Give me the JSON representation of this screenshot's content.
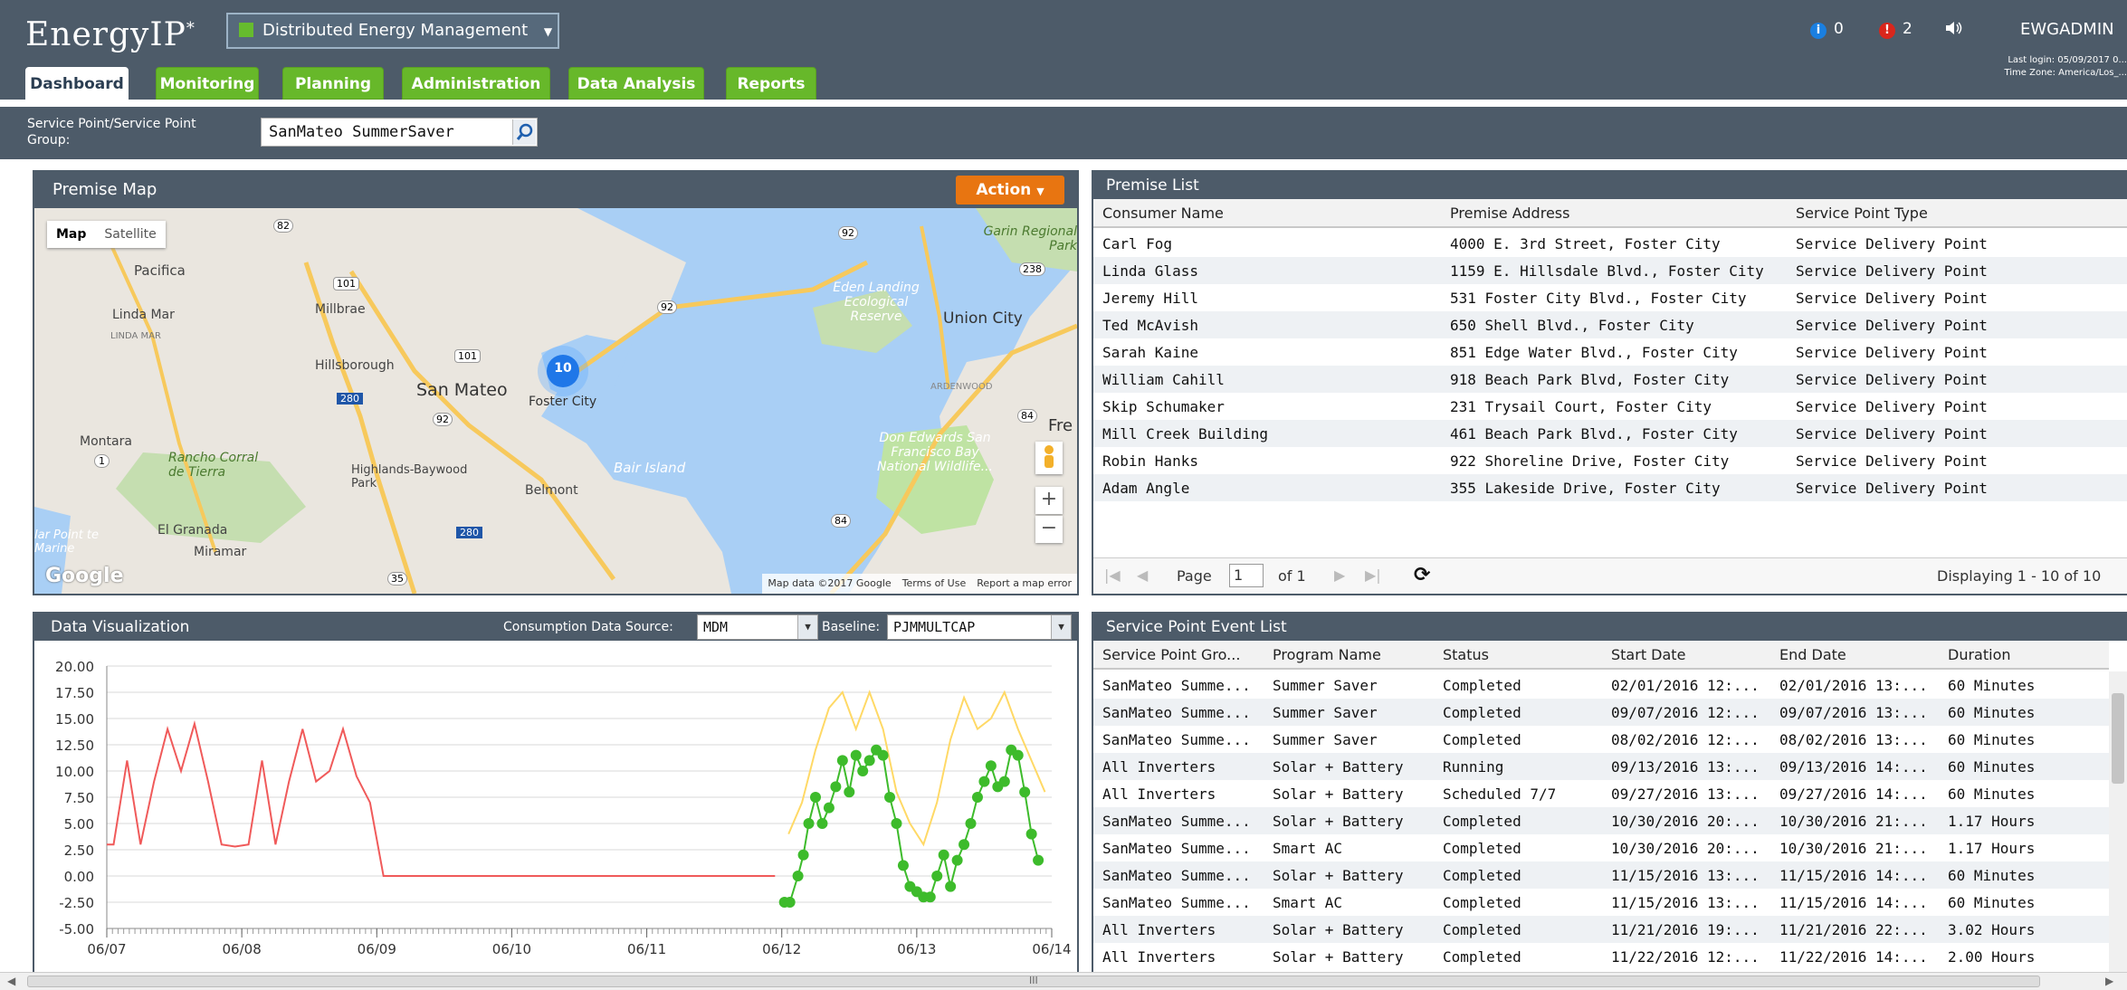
{
  "header": {
    "logo_text": "EnergyIP",
    "logo_mark": "*",
    "app_selector": "Distributed Energy Management",
    "info_count": "0",
    "alert_count": "2",
    "info_icon_letter": "i",
    "alert_icon_letter": "!",
    "username": "EWGADMIN",
    "last_login": "Last login: 05/09/2017 0...",
    "time_zone": "Time Zone: America/Los_..."
  },
  "tabs": [
    "Dashboard",
    "Monitoring",
    "Planning",
    "Administration",
    "Data Analysis",
    "Reports"
  ],
  "filter": {
    "label": "Service Point/Service Point Group:",
    "value": "SanMateo SummerSaver"
  },
  "premise_map": {
    "title": "Premise Map",
    "action_label": "Action",
    "map_type_map": "Map",
    "map_type_satellite": "Satellite",
    "cluster_count": "10",
    "zoom_in": "+",
    "zoom_out": "−",
    "google": "Google",
    "footer_mapdata": "Map data ©2017 Google",
    "footer_terms": "Terms of Use",
    "footer_report": "Report a map error",
    "places": [
      "Pacifica",
      "Linda Mar",
      "Millbrae",
      "Hillsborough",
      "San Mateo",
      "Foster City",
      "Montara",
      "Rancho Corral de Tierra",
      "Highlands-Baywood Park",
      "Belmont",
      "El Granada",
      "Miramar",
      "Garin Regional Park",
      "Eden Landing Ecological Reserve",
      "Union City",
      "Don Edwards San Francisco Bay National Wildlife...",
      "Bair Island",
      "lar Point te Marine",
      "Fre",
      "ARDENWOOD",
      "LINDA MAR"
    ],
    "roads": [
      "101",
      "280",
      "92",
      "1",
      "84",
      "238",
      "35",
      "82"
    ]
  },
  "premise_list": {
    "title": "Premise List",
    "columns": [
      "Consumer Name",
      "Premise Address",
      "Service Point Type"
    ],
    "rows": [
      [
        "Carl Fog",
        "4000 E. 3rd Street, Foster City",
        "Service Delivery Point"
      ],
      [
        "Linda Glass",
        "1159 E. Hillsdale Blvd., Foster City",
        "Service Delivery Point"
      ],
      [
        "Jeremy Hill",
        "531 Foster City Blvd., Foster City",
        "Service Delivery Point"
      ],
      [
        "Ted McAvish",
        "650 Shell Blvd., Foster City",
        "Service Delivery Point"
      ],
      [
        "Sarah Kaine",
        "851 Edge Water Blvd., Foster City",
        "Service Delivery Point"
      ],
      [
        "William Cahill",
        "918 Beach Park Blvd, Foster City",
        "Service Delivery Point"
      ],
      [
        "Skip Schumaker",
        "231 Trysail Court, Foster City",
        "Service Delivery Point"
      ],
      [
        "Mill Creek Building",
        "461 Beach Park Blvd., Foster City",
        "Service Delivery Point"
      ],
      [
        "Robin Hanks",
        "922 Shoreline Drive, Foster City",
        "Service Delivery Point"
      ],
      [
        "Adam Angle",
        "355 Lakeside Drive, Foster City",
        "Service Delivery Point"
      ]
    ],
    "pager_page_label": "Page",
    "pager_page": "1",
    "pager_of": "of 1",
    "pager_display": "Displaying 1 - 10 of 10"
  },
  "data_viz": {
    "title": "Data Visualization",
    "source_label": "Consumption Data Source:",
    "source_value": "MDM",
    "baseline_label": "Baseline:",
    "baseline_value": "PJMMULTCAP"
  },
  "event_list": {
    "title": "Service Point Event List",
    "columns": [
      "Service Point Gro...",
      "Program Name",
      "Status",
      "Start Date",
      "End Date",
      "Duration"
    ],
    "rows": [
      [
        "SanMateo Summe...",
        "Summer Saver",
        "Completed",
        "02/01/2016 12:...",
        "02/01/2016 13:...",
        "60 Minutes"
      ],
      [
        "SanMateo Summe...",
        "Summer Saver",
        "Completed",
        "09/07/2016 12:...",
        "09/07/2016 13:...",
        "60 Minutes"
      ],
      [
        "SanMateo Summe...",
        "Summer Saver",
        "Completed",
        "08/02/2016 12:...",
        "08/02/2016 13:...",
        "60 Minutes"
      ],
      [
        "All Inverters",
        "Solar + Battery",
        "Running",
        "09/13/2016 13:...",
        "09/13/2016 14:...",
        "60 Minutes"
      ],
      [
        "All Inverters",
        "Solar + Battery",
        "Scheduled 7/7",
        "09/27/2016 13:...",
        "09/27/2016 14:...",
        "60 Minutes"
      ],
      [
        "SanMateo Summe...",
        "Solar + Battery",
        "Completed",
        "10/30/2016 20:...",
        "10/30/2016 21:...",
        "1.17 Hours"
      ],
      [
        "SanMateo Summe...",
        "Smart AC",
        "Completed",
        "10/30/2016 20:...",
        "10/30/2016 21:...",
        "1.17 Hours"
      ],
      [
        "SanMateo Summe...",
        "Solar + Battery",
        "Completed",
        "11/15/2016 13:...",
        "11/15/2016 14:...",
        "60 Minutes"
      ],
      [
        "SanMateo Summe...",
        "Smart AC",
        "Completed",
        "11/15/2016 13:...",
        "11/15/2016 14:...",
        "60 Minutes"
      ],
      [
        "All Inverters",
        "Solar + Battery",
        "Completed",
        "11/21/2016 19:...",
        "11/21/2016 22:...",
        "3.02 Hours"
      ],
      [
        "All Inverters",
        "Solar + Battery",
        "Completed",
        "11/22/2016 12:...",
        "11/22/2016 14:...",
        "2.00 Hours"
      ]
    ]
  },
  "scrollbar_grip": "III",
  "colors": {
    "header_bg": "#4d5b69",
    "tab_green": "#67b82a",
    "action_orange": "#e87511",
    "series_red": "#f05a5a",
    "series_yellow": "#ffd966",
    "series_green": "#3dbb2b",
    "water": "#a9cff5",
    "land": "#eae6df"
  },
  "chart_data": {
    "type": "line",
    "title": "",
    "xlabel": "",
    "ylabel": "",
    "ylim": [
      -5,
      20
    ],
    "xlim": [
      0,
      7
    ],
    "x_ticks": [
      0,
      1,
      2,
      3,
      4,
      5,
      6,
      7
    ],
    "x_tick_labels": [
      "06/07",
      "06/08",
      "06/09",
      "06/10",
      "06/11",
      "06/12",
      "06/13",
      "06/14"
    ],
    "y_ticks": [
      -5,
      -2.5,
      0,
      2.5,
      5,
      7.5,
      10,
      12.5,
      15,
      17.5,
      20
    ],
    "y_tick_labels": [
      "-5.00",
      "-2.50",
      "0.00",
      "2.50",
      "5.00",
      "7.50",
      "10.00",
      "12.50",
      "15.00",
      "17.50",
      "20.00"
    ],
    "grid": true,
    "legend": "none",
    "series": [
      {
        "color": "#f05a5a",
        "markers": false,
        "x": [
          0,
          0.05,
          0.15,
          0.25,
          0.35,
          0.45,
          0.55,
          0.65,
          0.75,
          0.85,
          0.95,
          1.05,
          1.15,
          1.25,
          1.35,
          1.45,
          1.55,
          1.65,
          1.75,
          1.85,
          1.95,
          2.05,
          3,
          4,
          4.95
        ],
        "y": [
          3,
          3,
          11,
          3,
          9,
          14,
          10,
          14.5,
          9,
          3,
          2.8,
          3,
          11,
          3,
          9,
          14,
          9,
          10,
          14,
          9.5,
          7,
          0,
          0,
          0,
          0
        ]
      },
      {
        "color": "#ffd966",
        "markers": false,
        "x": [
          5.05,
          5.15,
          5.25,
          5.35,
          5.45,
          5.55,
          5.65,
          5.75,
          5.85,
          5.95,
          6.05,
          6.15,
          6.25,
          6.35,
          6.45,
          6.55,
          6.65,
          6.75,
          6.85,
          6.95
        ],
        "y": [
          4,
          7,
          12,
          16,
          17.5,
          14,
          17.5,
          14,
          8,
          5,
          3,
          7,
          13,
          17,
          14,
          15,
          17.5,
          14,
          11,
          8
        ]
      },
      {
        "color": "#3dbb2b",
        "markers": true,
        "x": [
          5.02,
          5.06,
          5.12,
          5.16,
          5.2,
          5.25,
          5.3,
          5.35,
          5.4,
          5.45,
          5.5,
          5.55,
          5.6,
          5.65,
          5.7,
          5.75,
          5.8,
          5.85,
          5.9,
          5.95,
          6.0,
          6.05,
          6.1,
          6.15,
          6.2,
          6.25,
          6.3,
          6.35,
          6.4,
          6.45,
          6.5,
          6.55,
          6.6,
          6.65,
          6.7,
          6.75,
          6.8,
          6.85,
          6.9
        ],
        "y": [
          -2.5,
          -2.5,
          0,
          2,
          5,
          7.5,
          5,
          6.5,
          8.5,
          11,
          8,
          11.5,
          10,
          11,
          12,
          11.5,
          7.5,
          5,
          1,
          -1,
          -1.5,
          -2,
          -2,
          0,
          2,
          -1,
          1.5,
          3,
          5,
          7.5,
          9,
          10.5,
          8.5,
          9,
          12,
          11.5,
          8,
          4,
          1.5
        ]
      }
    ]
  }
}
